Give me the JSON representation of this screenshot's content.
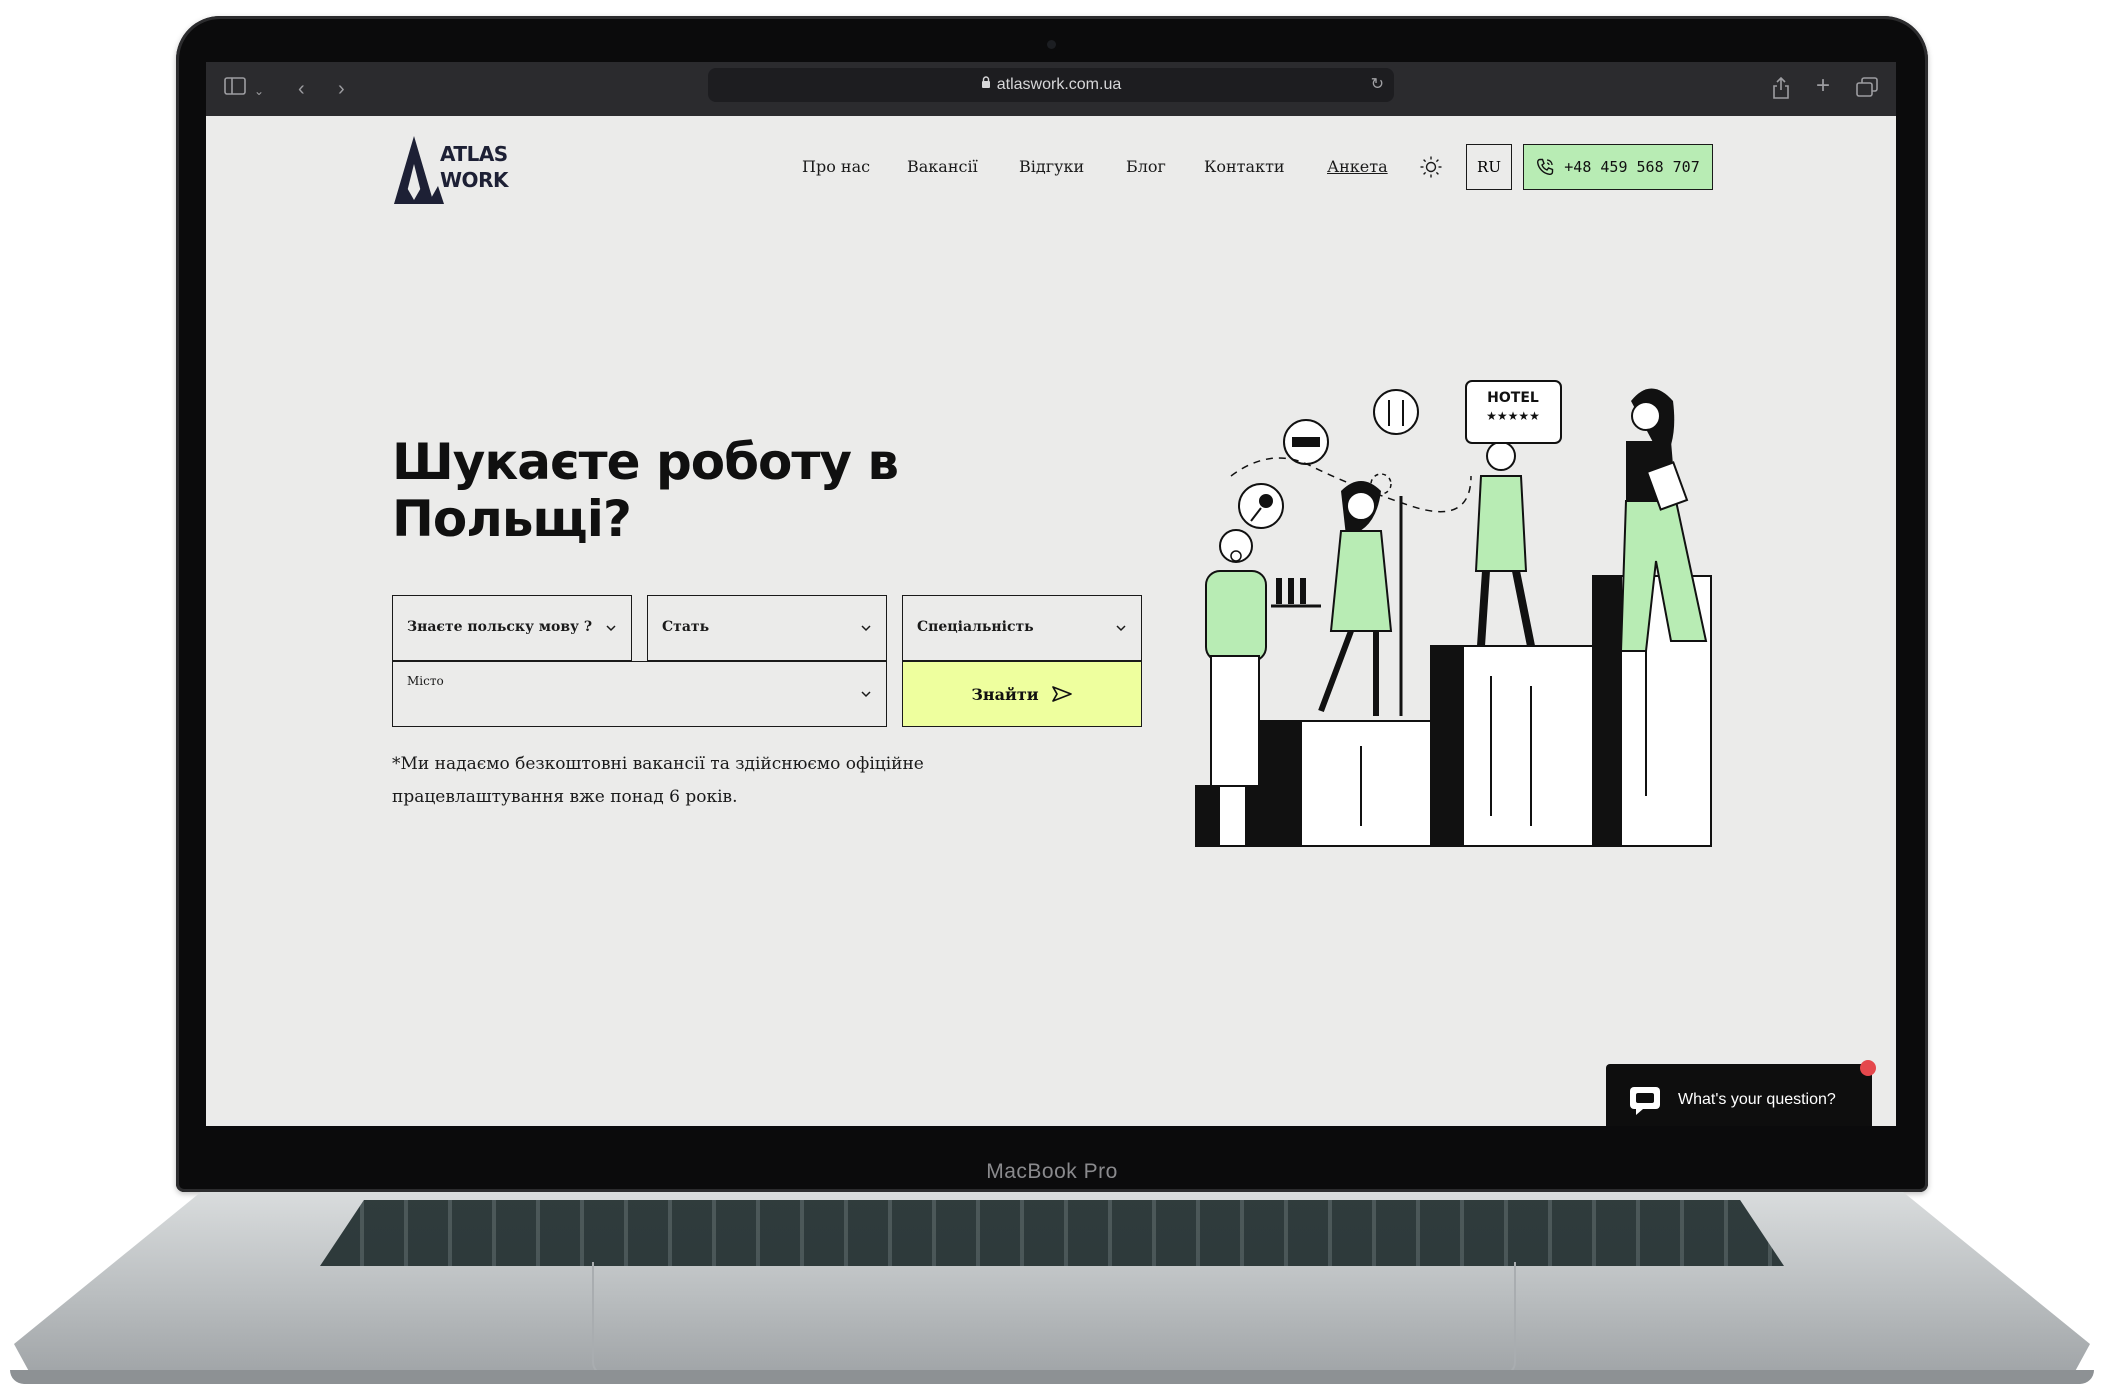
{
  "device": {
    "label": "MacBook Pro"
  },
  "browser": {
    "url": "atlaswork.com.ua"
  },
  "header": {
    "logo_line1": "ATLAS",
    "logo_line2": "WORK",
    "nav": [
      "Про нас",
      "Вакансії",
      "Відгуки",
      "Блог",
      "Контакти",
      "Анкета"
    ],
    "lang": "RU",
    "phone": "+48 459 568 707"
  },
  "hero": {
    "title": "Шукаєте роботу в Польщі?",
    "filters": {
      "language": "Знаєте польску мову ?",
      "gender": "Стать",
      "specialty": "Спеціальність",
      "city": "Місто"
    },
    "search_label": "Знайти",
    "note": "*Ми надаємо безкоштовні вакансії та здійснюємо офіційне працевлаштування вже понад 6 років."
  },
  "illustration": {
    "sign": "HOTEL",
    "stars": "★★★★★"
  },
  "chat": {
    "label": "What's your question?"
  },
  "colors": {
    "accent_green": "#b8ecb4",
    "accent_yellow": "#eeff9e",
    "page_bg": "#ebebea",
    "ink": "#1a1a1a"
  }
}
